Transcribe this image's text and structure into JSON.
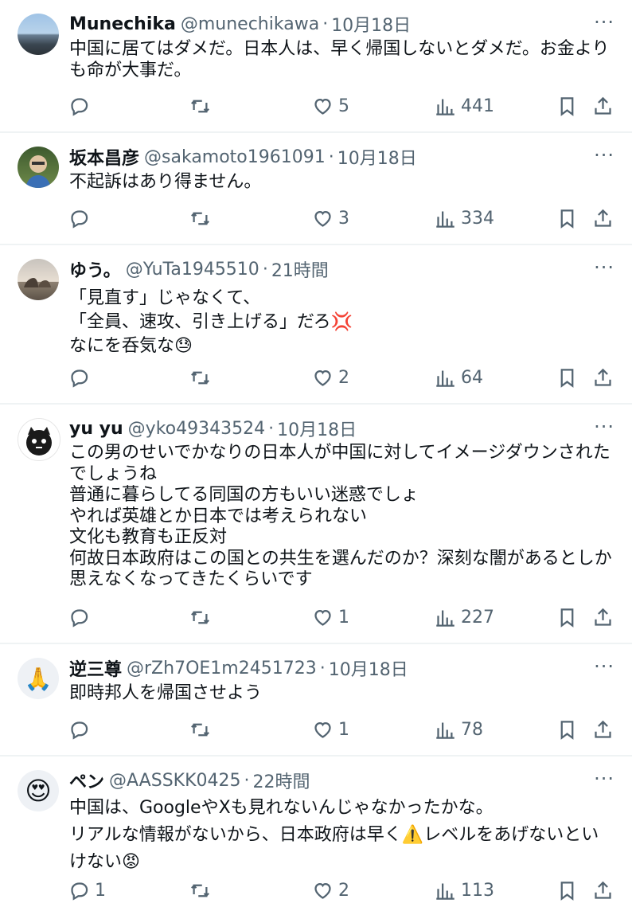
{
  "tweets": [
    {
      "name": "Munechika",
      "handle": "@munechikawa",
      "time": "10月18日",
      "lines": [
        "中国に居てはダメだ。日本人は、早く帰国しないとダメだ。お金より",
        "も命が大事だ。"
      ],
      "replies": "",
      "likes": "5",
      "views": "441"
    },
    {
      "name": "坂本昌彦",
      "handle": "@sakamoto1961091",
      "time": "10月18日",
      "lines": [
        "不起訴はあり得ません。"
      ],
      "replies": "",
      "likes": "3",
      "views": "334"
    },
    {
      "name": "ゆう。",
      "handle": "@YuTa1945510",
      "time": "21時間",
      "lines": [
        "「見直す」じゃなくて、",
        "「全員、速攻、引き上げる」だろ",
        "なにを呑気な"
      ],
      "emojis": [
        "💢",
        "😓"
      ],
      "replies": "",
      "likes": "2",
      "views": "64"
    },
    {
      "name": "yu yu",
      "handle": "@yko49343524",
      "time": "10月18日",
      "lines": [
        "この男のせいでかなりの日本人が中国に対してイメージダウンされた",
        "でしょうね",
        "普通に暮らしてる同国の方もいい迷惑でしょ",
        "やれば英雄とか日本では考えられない",
        "文化も教育も正反対",
        "何故日本政府はこの国との共生を選んだのか？深刻な闇があるとしか",
        "思えなくなってきたくらいです"
      ],
      "replies": "",
      "likes": "1",
      "views": "227"
    },
    {
      "name": "逆三尊",
      "handle": "@rZh7OE1m2451723",
      "time": "10月18日",
      "lines": [
        "即時邦人を帰国させよう"
      ],
      "avatar_emoji": "🙏",
      "replies": "",
      "likes": "1",
      "views": "78"
    },
    {
      "name": "ペン",
      "handle": "@AASSKK0425",
      "time": "22時間",
      "lines": [
        "中国は、GoogleやXも見れないんじゃなかったかな。",
        "リアルな情報がないから、日本政府は早く",
        "レベルをあげないとい",
        "けない"
      ],
      "emojis": [
        "⚠️",
        "😡"
      ],
      "avatar_emoji": "😍",
      "replies": "1",
      "likes": "2",
      "views": "113"
    }
  ],
  "icons": {
    "reply": "reply-icon",
    "retweet": "retweet-icon",
    "like": "heart-icon",
    "views": "views-icon",
    "bookmark": "bookmark-icon",
    "share": "share-icon",
    "more": "more-icon"
  },
  "more_glyph": "···"
}
